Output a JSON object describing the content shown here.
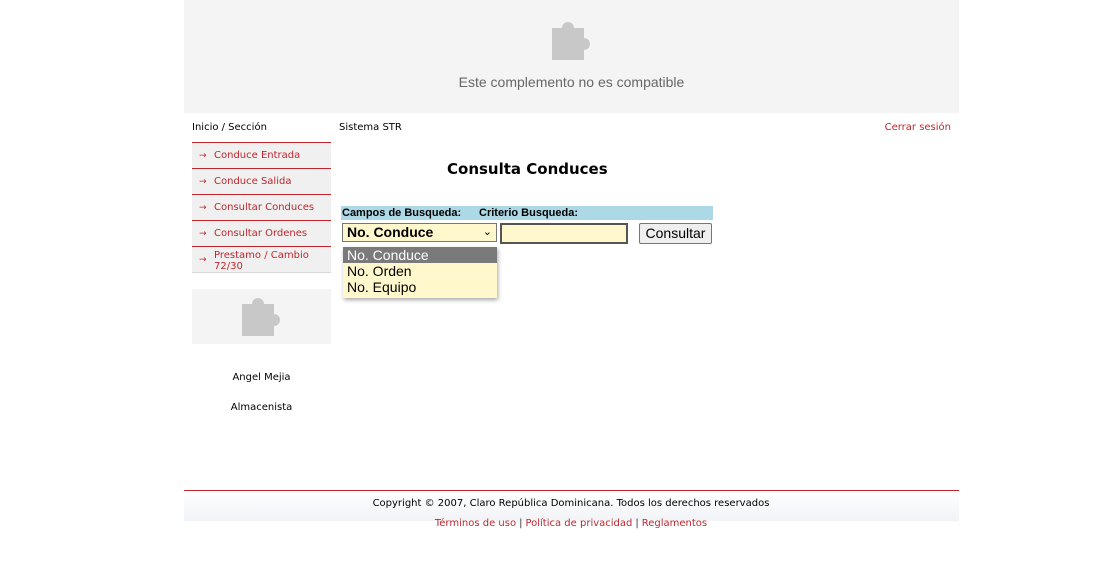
{
  "plugin": {
    "message": "Este complemento no es compatible",
    "icon": "puzzle-icon"
  },
  "header": {
    "breadcrumb": "Inicio / Sección",
    "system_title": "Sistema STR",
    "logout": "Cerrar sesión"
  },
  "sidebar": {
    "items": [
      {
        "label": "Conduce Entrada"
      },
      {
        "label": "Conduce Salida"
      },
      {
        "label": "Consultar Conduces"
      },
      {
        "label": "Consultar Ordenes"
      },
      {
        "label": "Prestamo / Cambio 72/30"
      }
    ],
    "arrow": "→",
    "user_name": "Angel Mejia",
    "user_role": "Almacenista"
  },
  "main": {
    "title": "Consulta Conduces",
    "header_fields": "Campos de Busqueda:",
    "header_criteria": "Criterio Busqueda:",
    "select_value": "No. Conduce",
    "criteria_value": "",
    "button": "Consultar",
    "options": [
      "No. Conduce",
      "No. Orden",
      "No. Equipo"
    ]
  },
  "footer": {
    "copyright": "Copyright © 2007, Claro República Dominicana. Todos los derechos reservados",
    "links": [
      "Términos de uso",
      "Política de privacidad",
      "Reglamentos"
    ],
    "separator": "|"
  },
  "colors": {
    "accent": "#c0262c",
    "header_bg": "#add8e6",
    "field_bg": "#fff8cc"
  }
}
